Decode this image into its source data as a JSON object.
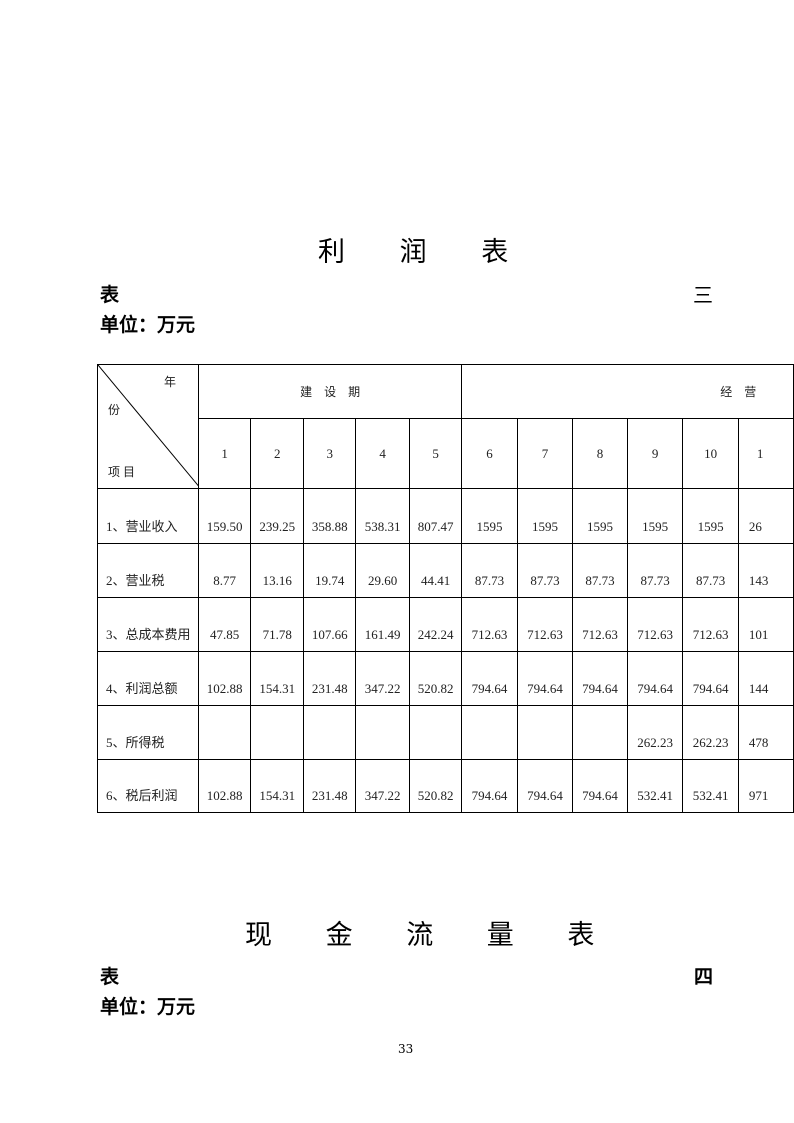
{
  "profit_table": {
    "title_chars": [
      "利",
      "润",
      "表"
    ],
    "table_label": "表",
    "table_number": "三",
    "unit": "单位：万元",
    "corner": {
      "top": "年",
      "middle": "份",
      "bottom": "项 目"
    },
    "period_headers": [
      "建　设　期",
      "经　营"
    ],
    "years": [
      "1",
      "2",
      "3",
      "4",
      "5",
      "6",
      "7",
      "8",
      "9",
      "10",
      "1"
    ],
    "rows": [
      {
        "label": "1、营业收入",
        "values": [
          "159.50",
          "239.25",
          "358.88",
          "538.31",
          "807.47",
          "1595",
          "1595",
          "1595",
          "1595",
          "1595",
          "26"
        ]
      },
      {
        "label": "2、营业税",
        "values": [
          "8.77",
          "13.16",
          "19.74",
          "29.60",
          "44.41",
          "87.73",
          "87.73",
          "87.73",
          "87.73",
          "87.73",
          "143"
        ]
      },
      {
        "label": "3、总成本费用",
        "values": [
          "47.85",
          "71.78",
          "107.66",
          "161.49",
          "242.24",
          "712.63",
          "712.63",
          "712.63",
          "712.63",
          "712.63",
          "101"
        ]
      },
      {
        "label": "4、利润总额",
        "values": [
          "102.88",
          "154.31",
          "231.48",
          "347.22",
          "520.82",
          "794.64",
          "794.64",
          "794.64",
          "794.64",
          "794.64",
          "144"
        ]
      },
      {
        "label": "5、所得税",
        "values": [
          "",
          "",
          "",
          "",
          "",
          "",
          "",
          "",
          "262.23",
          "262.23",
          "478"
        ]
      },
      {
        "label": "6、税后利润",
        "values": [
          "102.88",
          "154.31",
          "231.48",
          "347.22",
          "520.82",
          "794.64",
          "794.64",
          "794.64",
          "532.41",
          "532.41",
          "971"
        ]
      }
    ]
  },
  "cashflow_table": {
    "title_chars": [
      "现",
      "金",
      "流",
      "量",
      "表"
    ],
    "table_label": "表",
    "table_number": "四",
    "unit": "单位：万元"
  },
  "page_number": "33"
}
